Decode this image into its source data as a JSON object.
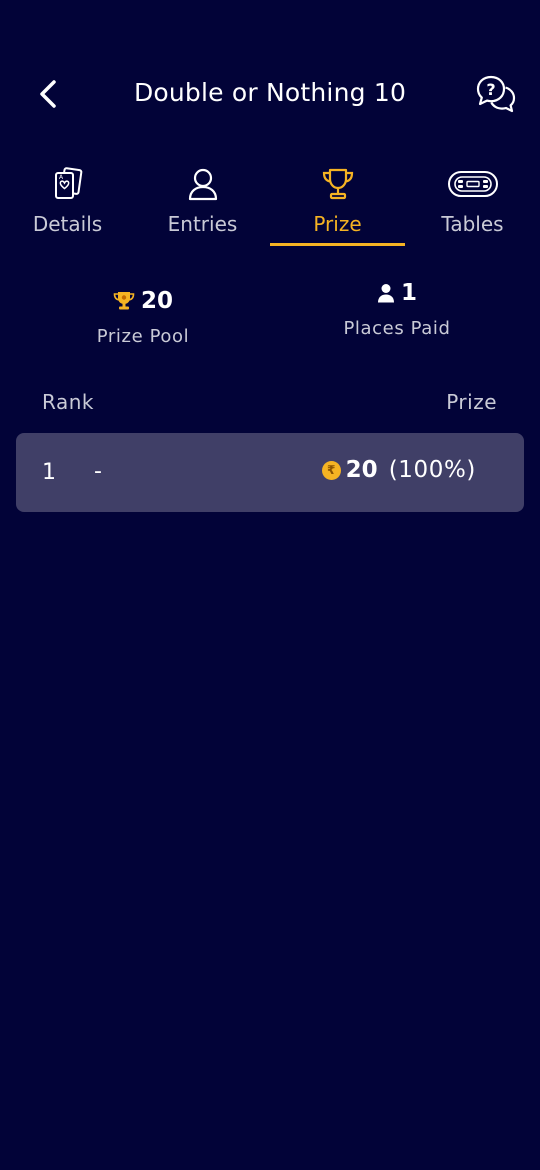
{
  "header": {
    "title": "Double or Nothing 10"
  },
  "tabs": [
    {
      "label": "Details",
      "icon": "cards-icon",
      "active": false
    },
    {
      "label": "Entries",
      "icon": "person-icon",
      "active": false
    },
    {
      "label": "Prize",
      "icon": "trophy-icon",
      "active": true
    },
    {
      "label": "Tables",
      "icon": "poker-table-icon",
      "active": false
    }
  ],
  "stats": {
    "prize_pool": {
      "value": "20",
      "label": "Prize Pool",
      "icon": "trophy-icon"
    },
    "places_paid": {
      "value": "1",
      "label": "Places Paid",
      "icon": "person-icon"
    }
  },
  "table": {
    "rank_header": "Rank",
    "prize_header": "Prize",
    "rows": [
      {
        "rank": "1",
        "player": "-",
        "coin": "₹",
        "amount": "20",
        "percent": "(100%)"
      }
    ]
  },
  "colors": {
    "background": "#020338",
    "accent": "#f5b323",
    "row_background": "#403f67"
  }
}
